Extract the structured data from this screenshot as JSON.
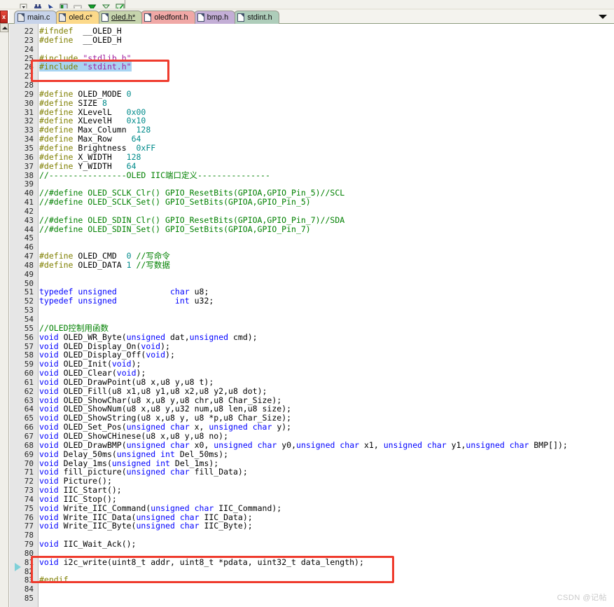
{
  "toolbar": {
    "icons": [
      "dropdown-arrow-icon",
      "binoculars-icon",
      "arrow-icon",
      "bookmark-icon",
      "rectangle-icon",
      "green-diamond-down-icon",
      "filter-icon",
      "green-check-icon"
    ]
  },
  "window": {
    "close_label": "x"
  },
  "tabbar": {
    "dropdown_label": "tab-list-dropdown",
    "tabs": [
      {
        "label": "main.c",
        "color": "#c7d3ea",
        "active": false,
        "modified": false
      },
      {
        "label": "oled.c*",
        "color": "#fcd98a",
        "active": false,
        "modified": true
      },
      {
        "label": "oled.h*",
        "color": "#c6d4ad",
        "active": true,
        "modified": true
      },
      {
        "label": "oledfont.h",
        "color": "#f0a8a6",
        "active": false,
        "modified": false
      },
      {
        "label": "bmp.h",
        "color": "#c3aed6",
        "active": false,
        "modified": false
      },
      {
        "label": "stdint.h",
        "color": "#aecdba",
        "active": false,
        "modified": false
      }
    ]
  },
  "annotations": {
    "highlight_box_1": "red-box-around-include-stdint",
    "highlight_box_2": "red-box-around-i2c-write-declaration",
    "selection_line": 26
  },
  "watermark": "CSDN @记帖",
  "editor": {
    "first_line": 22,
    "lines": [
      {
        "n": 22,
        "tokens": [
          {
            "t": "#ifndef",
            "c": "pp"
          },
          {
            "t": "  __OLED_H",
            "c": "pl"
          }
        ]
      },
      {
        "n": 23,
        "tokens": [
          {
            "t": "#define",
            "c": "pp"
          },
          {
            "t": "  __OLED_H",
            "c": "pl"
          }
        ]
      },
      {
        "n": 24,
        "tokens": []
      },
      {
        "n": 25,
        "tokens": [
          {
            "t": "#include",
            "c": "pp"
          },
          {
            "t": " ",
            "c": "pl"
          },
          {
            "t": "\"stdlib.h\"",
            "c": "str"
          }
        ]
      },
      {
        "n": 26,
        "sel": true,
        "tokens": [
          {
            "t": "#include",
            "c": "pp"
          },
          {
            "t": " ",
            "c": "pl"
          },
          {
            "t": "\"stdint.h\"",
            "c": "str"
          }
        ]
      },
      {
        "n": 27,
        "tokens": []
      },
      {
        "n": 28,
        "tokens": []
      },
      {
        "n": 29,
        "tokens": [
          {
            "t": "#define",
            "c": "pp"
          },
          {
            "t": " OLED_MODE ",
            "c": "pl"
          },
          {
            "t": "0",
            "c": "num"
          }
        ]
      },
      {
        "n": 30,
        "tokens": [
          {
            "t": "#define",
            "c": "pp"
          },
          {
            "t": " SIZE ",
            "c": "pl"
          },
          {
            "t": "8",
            "c": "num"
          }
        ]
      },
      {
        "n": 31,
        "tokens": [
          {
            "t": "#define",
            "c": "pp"
          },
          {
            "t": " XLevelL   ",
            "c": "pl"
          },
          {
            "t": "0x00",
            "c": "num"
          }
        ]
      },
      {
        "n": 32,
        "tokens": [
          {
            "t": "#define",
            "c": "pp"
          },
          {
            "t": " XLevelH   ",
            "c": "pl"
          },
          {
            "t": "0x10",
            "c": "num"
          }
        ]
      },
      {
        "n": 33,
        "tokens": [
          {
            "t": "#define",
            "c": "pp"
          },
          {
            "t": " Max_Column  ",
            "c": "pl"
          },
          {
            "t": "128",
            "c": "num"
          }
        ]
      },
      {
        "n": 34,
        "tokens": [
          {
            "t": "#define",
            "c": "pp"
          },
          {
            "t": " Max_Row    ",
            "c": "pl"
          },
          {
            "t": "64",
            "c": "num"
          }
        ]
      },
      {
        "n": 35,
        "tokens": [
          {
            "t": "#define",
            "c": "pp"
          },
          {
            "t": " Brightness  ",
            "c": "pl"
          },
          {
            "t": "0xFF",
            "c": "num"
          }
        ]
      },
      {
        "n": 36,
        "tokens": [
          {
            "t": "#define",
            "c": "pp"
          },
          {
            "t": " X_WIDTH   ",
            "c": "pl"
          },
          {
            "t": "128",
            "c": "num"
          }
        ]
      },
      {
        "n": 37,
        "tokens": [
          {
            "t": "#define",
            "c": "pp"
          },
          {
            "t": " Y_WIDTH   ",
            "c": "pl"
          },
          {
            "t": "64",
            "c": "num"
          }
        ]
      },
      {
        "n": 38,
        "tokens": [
          {
            "t": "//----------------OLED IIC端口定义---------------",
            "c": "cmt"
          }
        ]
      },
      {
        "n": 39,
        "tokens": []
      },
      {
        "n": 40,
        "tokens": [
          {
            "t": "//#define OLED_SCLK_Clr() GPIO_ResetBits(GPIOA,GPIO_Pin_5)//SCL",
            "c": "cmt"
          }
        ]
      },
      {
        "n": 41,
        "tokens": [
          {
            "t": "//#define OLED_SCLK_Set() GPIO_SetBits(GPIOA,GPIO_Pin_5)",
            "c": "cmt"
          }
        ]
      },
      {
        "n": 42,
        "tokens": []
      },
      {
        "n": 43,
        "tokens": [
          {
            "t": "//#define OLED_SDIN_Clr() GPIO_ResetBits(GPIOA,GPIO_Pin_7)//SDA",
            "c": "cmt"
          }
        ]
      },
      {
        "n": 44,
        "tokens": [
          {
            "t": "//#define OLED_SDIN_Set() GPIO_SetBits(GPIOA,GPIO_Pin_7)",
            "c": "cmt"
          }
        ]
      },
      {
        "n": 45,
        "tokens": []
      },
      {
        "n": 46,
        "tokens": []
      },
      {
        "n": 47,
        "tokens": [
          {
            "t": "#define",
            "c": "pp"
          },
          {
            "t": " OLED_CMD  ",
            "c": "pl"
          },
          {
            "t": "0",
            "c": "num"
          },
          {
            "t": " ",
            "c": "pl"
          },
          {
            "t": "//写命令",
            "c": "cmt"
          }
        ]
      },
      {
        "n": 48,
        "tokens": [
          {
            "t": "#define",
            "c": "pp"
          },
          {
            "t": " OLED_DATA ",
            "c": "pl"
          },
          {
            "t": "1",
            "c": "num"
          },
          {
            "t": " ",
            "c": "pl"
          },
          {
            "t": "//写数据",
            "c": "cmt"
          }
        ]
      },
      {
        "n": 49,
        "tokens": []
      },
      {
        "n": 50,
        "tokens": []
      },
      {
        "n": 51,
        "tokens": [
          {
            "t": "typedef",
            "c": "kw"
          },
          {
            "t": " ",
            "c": "pl"
          },
          {
            "t": "unsigned",
            "c": "kw"
          },
          {
            "t": "           ",
            "c": "pl"
          },
          {
            "t": "char",
            "c": "kw"
          },
          {
            "t": " u8;",
            "c": "pl"
          }
        ]
      },
      {
        "n": 52,
        "tokens": [
          {
            "t": "typedef",
            "c": "kw"
          },
          {
            "t": " ",
            "c": "pl"
          },
          {
            "t": "unsigned",
            "c": "kw"
          },
          {
            "t": "            ",
            "c": "pl"
          },
          {
            "t": "int",
            "c": "kw"
          },
          {
            "t": " u32;",
            "c": "pl"
          }
        ]
      },
      {
        "n": 53,
        "tokens": []
      },
      {
        "n": 54,
        "tokens": []
      },
      {
        "n": 55,
        "tokens": [
          {
            "t": "//OLED控制用函数",
            "c": "cmt"
          }
        ]
      },
      {
        "n": 56,
        "tokens": [
          {
            "t": "void",
            "c": "kw"
          },
          {
            "t": " OLED_WR_Byte(",
            "c": "pl"
          },
          {
            "t": "unsigned",
            "c": "kw"
          },
          {
            "t": " dat,",
            "c": "pl"
          },
          {
            "t": "unsigned",
            "c": "kw"
          },
          {
            "t": " cmd);",
            "c": "pl"
          }
        ]
      },
      {
        "n": 57,
        "tokens": [
          {
            "t": "void",
            "c": "kw"
          },
          {
            "t": " OLED_Display_On(",
            "c": "pl"
          },
          {
            "t": "void",
            "c": "kw"
          },
          {
            "t": ");",
            "c": "pl"
          }
        ]
      },
      {
        "n": 58,
        "tokens": [
          {
            "t": "void",
            "c": "kw"
          },
          {
            "t": " OLED_Display_Off(",
            "c": "pl"
          },
          {
            "t": "void",
            "c": "kw"
          },
          {
            "t": ");",
            "c": "pl"
          }
        ]
      },
      {
        "n": 59,
        "tokens": [
          {
            "t": "void",
            "c": "kw"
          },
          {
            "t": " OLED_Init(",
            "c": "pl"
          },
          {
            "t": "void",
            "c": "kw"
          },
          {
            "t": ");",
            "c": "pl"
          }
        ]
      },
      {
        "n": 60,
        "tokens": [
          {
            "t": "void",
            "c": "kw"
          },
          {
            "t": " OLED_Clear(",
            "c": "pl"
          },
          {
            "t": "void",
            "c": "kw"
          },
          {
            "t": ");",
            "c": "pl"
          }
        ]
      },
      {
        "n": 61,
        "tokens": [
          {
            "t": "void",
            "c": "kw"
          },
          {
            "t": " OLED_DrawPoint(u8 x,u8 y,u8 t);",
            "c": "pl"
          }
        ]
      },
      {
        "n": 62,
        "tokens": [
          {
            "t": "void",
            "c": "kw"
          },
          {
            "t": " OLED_Fill(u8 x1,u8 y1,u8 x2,u8 y2,u8 dot);",
            "c": "pl"
          }
        ]
      },
      {
        "n": 63,
        "tokens": [
          {
            "t": "void",
            "c": "kw"
          },
          {
            "t": " OLED_ShowChar(u8 x,u8 y,u8 chr,u8 Char_Size);",
            "c": "pl"
          }
        ]
      },
      {
        "n": 64,
        "tokens": [
          {
            "t": "void",
            "c": "kw"
          },
          {
            "t": " OLED_ShowNum(u8 x,u8 y,u32 num,u8 len,u8 size);",
            "c": "pl"
          }
        ]
      },
      {
        "n": 65,
        "tokens": [
          {
            "t": "void",
            "c": "kw"
          },
          {
            "t": " OLED_ShowString(u8 x,u8 y, u8 *p,u8 Char_Size);",
            "c": "pl"
          }
        ]
      },
      {
        "n": 66,
        "tokens": [
          {
            "t": "void",
            "c": "kw"
          },
          {
            "t": " OLED_Set_Pos(",
            "c": "pl"
          },
          {
            "t": "unsigned",
            "c": "kw"
          },
          {
            "t": " ",
            "c": "pl"
          },
          {
            "t": "char",
            "c": "kw"
          },
          {
            "t": " x, ",
            "c": "pl"
          },
          {
            "t": "unsigned",
            "c": "kw"
          },
          {
            "t": " ",
            "c": "pl"
          },
          {
            "t": "char",
            "c": "kw"
          },
          {
            "t": " y);",
            "c": "pl"
          }
        ]
      },
      {
        "n": 67,
        "tokens": [
          {
            "t": "void",
            "c": "kw"
          },
          {
            "t": " OLED_ShowCHinese(u8 x,u8 y,u8 no);",
            "c": "pl"
          }
        ]
      },
      {
        "n": 68,
        "tokens": [
          {
            "t": "void",
            "c": "kw"
          },
          {
            "t": " OLED_DrawBMP(",
            "c": "pl"
          },
          {
            "t": "unsigned",
            "c": "kw"
          },
          {
            "t": " ",
            "c": "pl"
          },
          {
            "t": "char",
            "c": "kw"
          },
          {
            "t": " x0, ",
            "c": "pl"
          },
          {
            "t": "unsigned",
            "c": "kw"
          },
          {
            "t": " ",
            "c": "pl"
          },
          {
            "t": "char",
            "c": "kw"
          },
          {
            "t": " y0,",
            "c": "pl"
          },
          {
            "t": "unsigned",
            "c": "kw"
          },
          {
            "t": " ",
            "c": "pl"
          },
          {
            "t": "char",
            "c": "kw"
          },
          {
            "t": " x1, ",
            "c": "pl"
          },
          {
            "t": "unsigned",
            "c": "kw"
          },
          {
            "t": " ",
            "c": "pl"
          },
          {
            "t": "char",
            "c": "kw"
          },
          {
            "t": " y1,",
            "c": "pl"
          },
          {
            "t": "unsigned",
            "c": "kw"
          },
          {
            "t": " ",
            "c": "pl"
          },
          {
            "t": "char",
            "c": "kw"
          },
          {
            "t": " BMP[]);",
            "c": "pl"
          }
        ]
      },
      {
        "n": 69,
        "tokens": [
          {
            "t": "void",
            "c": "kw"
          },
          {
            "t": " Delay_50ms(",
            "c": "pl"
          },
          {
            "t": "unsigned",
            "c": "kw"
          },
          {
            "t": " ",
            "c": "pl"
          },
          {
            "t": "int",
            "c": "kw"
          },
          {
            "t": " Del_50ms);",
            "c": "pl"
          }
        ]
      },
      {
        "n": 70,
        "tokens": [
          {
            "t": "void",
            "c": "kw"
          },
          {
            "t": " Delay_1ms(",
            "c": "pl"
          },
          {
            "t": "unsigned",
            "c": "kw"
          },
          {
            "t": " ",
            "c": "pl"
          },
          {
            "t": "int",
            "c": "kw"
          },
          {
            "t": " Del_1ms);",
            "c": "pl"
          }
        ]
      },
      {
        "n": 71,
        "tokens": [
          {
            "t": "void",
            "c": "kw"
          },
          {
            "t": " fill_picture(",
            "c": "pl"
          },
          {
            "t": "unsigned",
            "c": "kw"
          },
          {
            "t": " ",
            "c": "pl"
          },
          {
            "t": "char",
            "c": "kw"
          },
          {
            "t": " fill_Data);",
            "c": "pl"
          }
        ]
      },
      {
        "n": 72,
        "tokens": [
          {
            "t": "void",
            "c": "kw"
          },
          {
            "t": " Picture();",
            "c": "pl"
          }
        ]
      },
      {
        "n": 73,
        "tokens": [
          {
            "t": "void",
            "c": "kw"
          },
          {
            "t": " IIC_Start();",
            "c": "pl"
          }
        ]
      },
      {
        "n": 74,
        "tokens": [
          {
            "t": "void",
            "c": "kw"
          },
          {
            "t": " IIC_Stop();",
            "c": "pl"
          }
        ]
      },
      {
        "n": 75,
        "tokens": [
          {
            "t": "void",
            "c": "kw"
          },
          {
            "t": " Write_IIC_Command(",
            "c": "pl"
          },
          {
            "t": "unsigned",
            "c": "kw"
          },
          {
            "t": " ",
            "c": "pl"
          },
          {
            "t": "char",
            "c": "kw"
          },
          {
            "t": " IIC_Command);",
            "c": "pl"
          }
        ]
      },
      {
        "n": 76,
        "tokens": [
          {
            "t": "void",
            "c": "kw"
          },
          {
            "t": " Write_IIC_Data(",
            "c": "pl"
          },
          {
            "t": "unsigned",
            "c": "kw"
          },
          {
            "t": " ",
            "c": "pl"
          },
          {
            "t": "char",
            "c": "kw"
          },
          {
            "t": " IIC_Data);",
            "c": "pl"
          }
        ]
      },
      {
        "n": 77,
        "tokens": [
          {
            "t": "void",
            "c": "kw"
          },
          {
            "t": " Write_IIC_Byte(",
            "c": "pl"
          },
          {
            "t": "unsigned",
            "c": "kw"
          },
          {
            "t": " ",
            "c": "pl"
          },
          {
            "t": "char",
            "c": "kw"
          },
          {
            "t": " IIC_Byte);",
            "c": "pl"
          }
        ]
      },
      {
        "n": 78,
        "tokens": []
      },
      {
        "n": 79,
        "tokens": [
          {
            "t": "void",
            "c": "kw"
          },
          {
            "t": " IIC_Wait_Ack();",
            "c": "pl"
          }
        ]
      },
      {
        "n": 80,
        "tokens": []
      },
      {
        "n": 81,
        "tokens": [
          {
            "t": "void",
            "c": "kw"
          },
          {
            "t": " i2c_write(uint8_t addr, uint8_t *pdata, uint32_t data_length);",
            "c": "pl"
          }
        ]
      },
      {
        "n": 82,
        "tokens": []
      },
      {
        "n": 83,
        "tokens": [
          {
            "t": "#endif",
            "c": "pp"
          }
        ]
      },
      {
        "n": 84,
        "tokens": []
      },
      {
        "n": 85,
        "tokens": []
      }
    ]
  }
}
